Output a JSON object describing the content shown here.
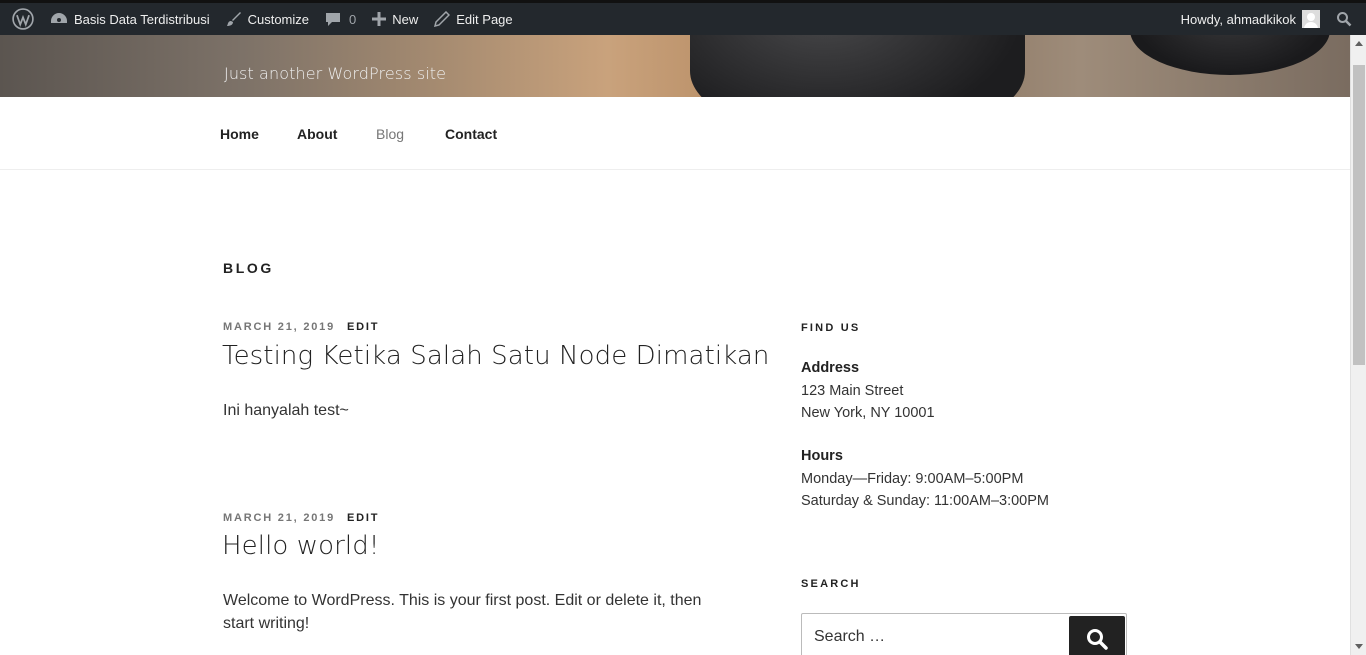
{
  "adminbar": {
    "site_name": "Basis Data Terdistribusi",
    "customize": "Customize",
    "comments_count": "0",
    "new": "New",
    "edit_page": "Edit Page",
    "howdy": "Howdy, ahmadkikok"
  },
  "header": {
    "tagline": "Just another WordPress site"
  },
  "nav": {
    "items": [
      {
        "label": "Home"
      },
      {
        "label": "About"
      },
      {
        "label": "Blog",
        "current": true
      },
      {
        "label": "Contact"
      }
    ]
  },
  "main": {
    "page_title": "BLOG",
    "posts": [
      {
        "date": "MARCH 21, 2019",
        "edit": "EDIT",
        "title": "Testing Ketika Salah Satu Node Dimatikan",
        "excerpt": "Ini hanyalah test~"
      },
      {
        "date": "MARCH 21, 2019",
        "edit": "EDIT",
        "title": "Hello world!",
        "excerpt": "Welcome to WordPress. This is your first post. Edit or delete it, then start writing!"
      }
    ]
  },
  "sidebar": {
    "find_us": {
      "title": "FIND US",
      "address_label": "Address",
      "address_line1": "123 Main Street",
      "address_line2": "New York, NY 10001",
      "hours_label": "Hours",
      "hours_line1": "Monday—Friday: 9:00AM–5:00PM",
      "hours_line2": "Saturday & Sunday: 11:00AM–3:00PM"
    },
    "search": {
      "title": "SEARCH",
      "placeholder": "Search …"
    }
  }
}
